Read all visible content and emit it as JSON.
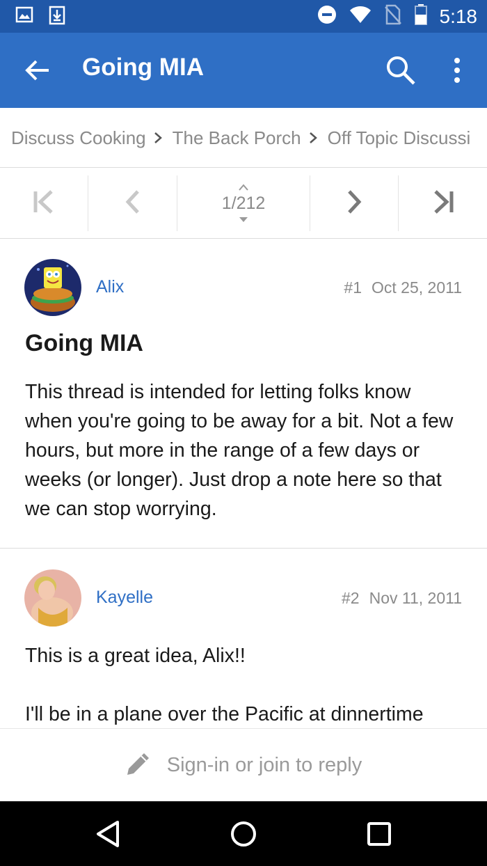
{
  "status_bar": {
    "time": "5:18",
    "icons": [
      "image-icon",
      "download-icon",
      "do-not-disturb-icon",
      "wifi-icon",
      "no-sim-icon",
      "battery-icon"
    ]
  },
  "app_bar": {
    "title": "Going MIA",
    "icons": [
      "back-arrow-icon",
      "search-icon",
      "more-vert-icon"
    ],
    "color": "#2f6fc5"
  },
  "breadcrumb": {
    "items": [
      "Discuss Cooking",
      "The Back Porch",
      "Off Topic Discussi"
    ]
  },
  "pager": {
    "page_label": "1/212",
    "icons": [
      "first-page-icon",
      "previous-page-icon",
      "next-page-icon",
      "last-page-icon"
    ]
  },
  "posts": [
    {
      "author": "Alix",
      "number": "#1",
      "date": "Oct 25, 2011",
      "title": "Going MIA",
      "body": "This thread is intended for letting folks know when you're going to be away for a bit. Not a few hours, but more in the range of a few days or weeks (or longer). Just drop a note here so that we can stop worrying."
    },
    {
      "author": "Kayelle",
      "number": "#2",
      "date": "Nov 11, 2011",
      "paragraphs": [
        "This is a great idea, Alix!!",
        "I'll be in a plane over the Pacific at dinnertime"
      ]
    }
  ],
  "reply_bar": {
    "label": "Sign-in or join to reply",
    "icon": "pencil-icon"
  },
  "nav_bar": {
    "icons": [
      "back-triangle-icon",
      "home-circle-icon",
      "recents-square-icon"
    ]
  },
  "colors": {
    "status_bar": "#2058a8",
    "link": "#2f6fc5",
    "muted_text": "#8a8a8a"
  }
}
